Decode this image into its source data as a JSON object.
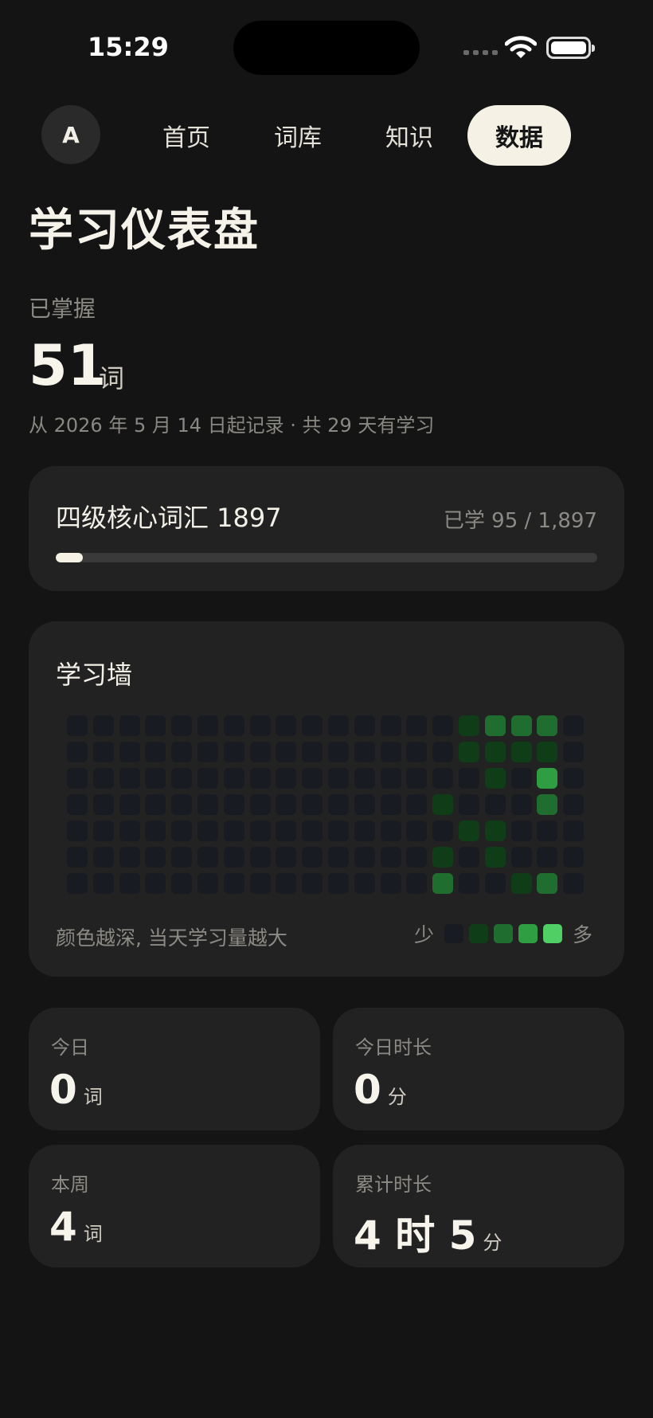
{
  "status": {
    "time": "15:29"
  },
  "nav": {
    "avatar": "A",
    "tabs": [
      "首页",
      "词库",
      "知识",
      "数据"
    ],
    "active_index": 3
  },
  "page": {
    "title": "学习仪表盘"
  },
  "mastered": {
    "label": "已掌握",
    "count": "51",
    "unit": "词",
    "record_text": "从 2026 年 5 月 14 日起记录 · 共 29 天有学习"
  },
  "vocab": {
    "name": "四级核心词汇 1897",
    "count_text": "已学 95 / 1,897",
    "learned": 95,
    "total": 1897
  },
  "wall": {
    "title": "学习墙",
    "hint": "颜色越深, 当天学习量越大",
    "legend_less": "少",
    "legend_more": "多",
    "colors": [
      "#181b22",
      "#0e3d17",
      "#1f6e2f",
      "#2f9e43",
      "#4fcf64"
    ],
    "columns": [
      [
        0,
        0,
        0,
        0,
        0,
        0,
        0
      ],
      [
        0,
        0,
        0,
        0,
        0,
        0,
        0
      ],
      [
        0,
        0,
        0,
        0,
        0,
        0,
        0
      ],
      [
        0,
        0,
        0,
        0,
        0,
        0,
        0
      ],
      [
        0,
        0,
        0,
        0,
        0,
        0,
        0
      ],
      [
        0,
        0,
        0,
        0,
        0,
        0,
        0
      ],
      [
        0,
        0,
        0,
        0,
        0,
        0,
        0
      ],
      [
        0,
        0,
        0,
        0,
        0,
        0,
        0
      ],
      [
        0,
        0,
        0,
        0,
        0,
        0,
        0
      ],
      [
        0,
        0,
        0,
        0,
        0,
        0,
        0
      ],
      [
        0,
        0,
        0,
        0,
        0,
        0,
        0
      ],
      [
        0,
        0,
        0,
        0,
        0,
        0,
        0
      ],
      [
        0,
        0,
        0,
        0,
        0,
        0,
        0
      ],
      [
        0,
        0,
        0,
        0,
        0,
        0,
        0
      ],
      [
        0,
        0,
        0,
        1,
        0,
        1,
        2
      ],
      [
        1,
        1,
        0,
        0,
        1,
        0,
        0
      ],
      [
        2,
        1,
        1,
        0,
        1,
        1,
        0
      ],
      [
        2,
        1,
        0,
        0,
        0,
        0,
        1
      ],
      [
        2,
        1,
        3,
        2,
        0,
        0,
        2
      ],
      [
        0,
        0,
        0,
        0,
        0,
        0,
        0
      ]
    ]
  },
  "stats": [
    {
      "label": "今日",
      "value": "0",
      "unit": "词"
    },
    {
      "label": "今日时长",
      "value": "0",
      "unit": "分"
    },
    {
      "label": "本周",
      "value": "4",
      "unit": "词"
    },
    {
      "label": "累计时长",
      "value": "4 时 5",
      "unit": "分"
    }
  ]
}
